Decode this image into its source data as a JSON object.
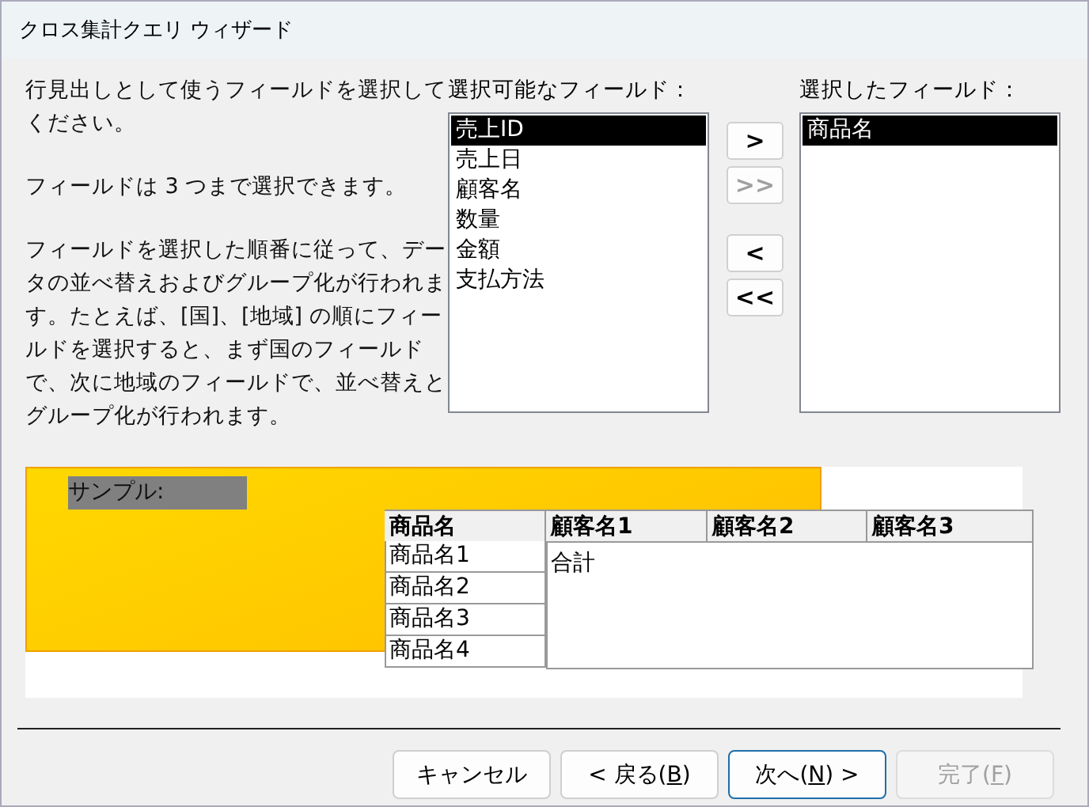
{
  "window": {
    "title": "クロス集計クエリ ウィザード"
  },
  "instructions": [
    "行見出しとして使うフィールドを選択してください。",
    "フィールドは 3 つまで選択できます。",
    "フィールドを選択した順番に従って、データの並べ替えおよびグループ化が行われます。たとえば、[国]、[地域] の順にフィールドを選択すると、まず国のフィールドで、次に地域のフィールドで、並べ替えとグループ化が行われます。"
  ],
  "available_fields": {
    "label": "選択可能なフィールド：",
    "items": [
      {
        "text": "売上ID",
        "selected": true
      },
      {
        "text": "売上日",
        "selected": false
      },
      {
        "text": "顧客名",
        "selected": false
      },
      {
        "text": "数量",
        "selected": false
      },
      {
        "text": "金額",
        "selected": false
      },
      {
        "text": "支払方法",
        "selected": false
      }
    ]
  },
  "move_buttons": [
    {
      "label": ">",
      "disabled": false
    },
    {
      "label": ">>",
      "disabled": true
    },
    {
      "label": "<",
      "disabled": false
    },
    {
      "label": "<<",
      "disabled": false
    }
  ],
  "selected_fields": {
    "label": "選択したフィールド：",
    "items": [
      {
        "text": "商品名",
        "selected": true
      }
    ]
  },
  "sample": {
    "label": "サンプル:",
    "row_header": "商品名",
    "row_items": [
      "商品名1",
      "商品名2",
      "商品名3",
      "商品名4"
    ],
    "column_headers": [
      "顧客名1",
      "顧客名2",
      "顧客名3"
    ],
    "cell": "合計"
  },
  "buttons": [
    {
      "label_before": "キャンセル",
      "disabled": false,
      "default": false
    },
    {
      "label_before": "< 戻る(",
      "accel": "B",
      "label_after": ")",
      "disabled": false,
      "default": false
    },
    {
      "label_before": "次へ(",
      "accel": "N",
      "label_after": ") >",
      "disabled": false,
      "default": true
    },
    {
      "label_before": "完了(",
      "accel": "F",
      "label_after": ")",
      "disabled": true,
      "default": false
    }
  ]
}
